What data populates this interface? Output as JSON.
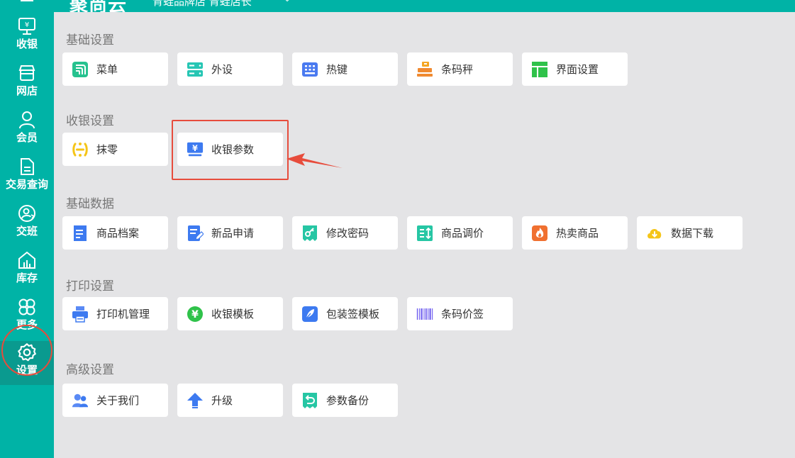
{
  "header": {
    "brand": "聚尚云",
    "store_name": "青蛙品牌店  青蛙店长",
    "chevron": "⌄"
  },
  "sidebar": {
    "items": [
      {
        "label": "收银",
        "icon": "cashier-monitor-icon"
      },
      {
        "label": "网店",
        "icon": "store-icon"
      },
      {
        "label": "会员",
        "icon": "user-icon"
      },
      {
        "label": "交易查询",
        "icon": "document-icon"
      },
      {
        "label": "交班",
        "icon": "shift-user-icon"
      },
      {
        "label": "库存",
        "icon": "warehouse-icon"
      },
      {
        "label": "更多",
        "icon": "clover-icon"
      },
      {
        "label": "设置",
        "icon": "gear-icon",
        "active": true
      }
    ]
  },
  "sections": [
    {
      "title": "基础设置",
      "items": [
        {
          "label": "菜单",
          "icon": "menu-icon",
          "color": "#26c28f"
        },
        {
          "label": "外设",
          "icon": "peripheral-icon",
          "color": "#26c6b4"
        },
        {
          "label": "热键",
          "icon": "keyboard-icon",
          "color": "#4a7af0"
        },
        {
          "label": "条码秤",
          "icon": "barcode-scale-icon",
          "color": "#f08a30"
        },
        {
          "label": "界面设置",
          "icon": "layout-icon",
          "color": "#2fc24a"
        }
      ]
    },
    {
      "title": "收银设置",
      "items": [
        {
          "label": "抹零",
          "icon": "round-off-icon",
          "color": "#f5c518"
        },
        {
          "label": "收银参数",
          "icon": "cashier-params-icon",
          "color": "#3d7af0"
        }
      ]
    },
    {
      "title": "基础数据",
      "items": [
        {
          "label": "商品档案",
          "icon": "product-file-icon",
          "color": "#3d7af0"
        },
        {
          "label": "新品申请",
          "icon": "new-product-icon",
          "color": "#3d7af0"
        },
        {
          "label": "修改密码",
          "icon": "key-icon",
          "color": "#26c6a4"
        },
        {
          "label": "商品调价",
          "icon": "price-adjust-icon",
          "color": "#26c6a4"
        },
        {
          "label": "热卖商品",
          "icon": "hot-icon",
          "color": "#f07030"
        },
        {
          "label": "数据下载",
          "icon": "download-icon",
          "color": "#f5c518"
        }
      ]
    },
    {
      "title": "打印设置",
      "items": [
        {
          "label": "打印机管理",
          "icon": "printer-icon",
          "color": "#3d7af0"
        },
        {
          "label": "收银模板",
          "icon": "yuan-template-icon",
          "color": "#2fc24a"
        },
        {
          "label": "包装签模板",
          "icon": "feather-icon",
          "color": "#3d7af0"
        },
        {
          "label": "条码价签",
          "icon": "barcode-icon",
          "color": "#7a6af0"
        }
      ]
    },
    {
      "title": "高级设置",
      "items": [
        {
          "label": "关于我们",
          "icon": "about-users-icon",
          "color": "#3d7af0"
        },
        {
          "label": "升级",
          "icon": "upgrade-arrow-icon",
          "color": "#3d7af0"
        },
        {
          "label": "参数备份",
          "icon": "backup-icon",
          "color": "#26c6a4"
        }
      ]
    }
  ]
}
